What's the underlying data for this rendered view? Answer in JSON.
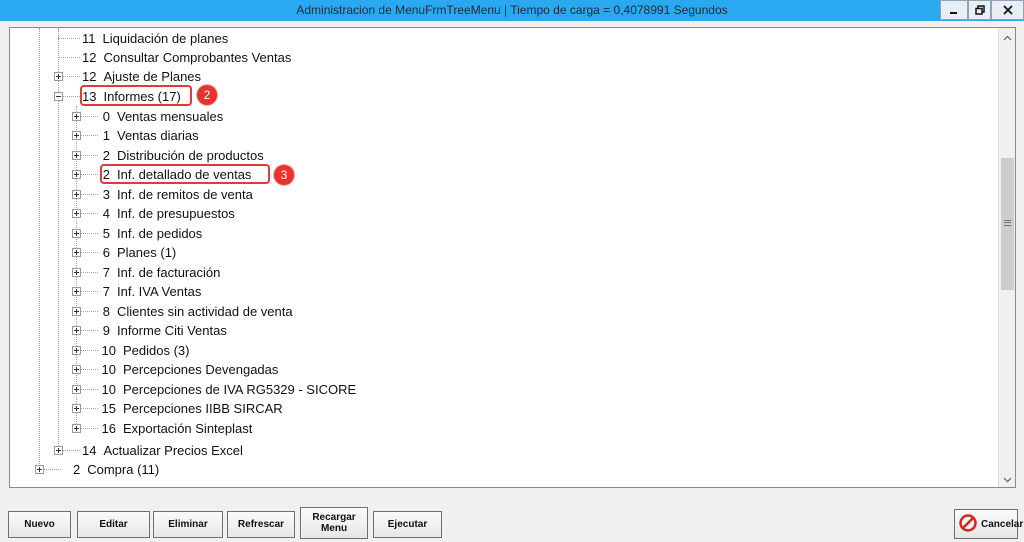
{
  "window": {
    "title": "Administracion de MenuFrmTreeMenu | Tiempo de carga = 0,4078991 Segundos",
    "controls": [
      "minimize-icon",
      "restore-icon",
      "close-icon"
    ]
  },
  "tree": {
    "items": [
      {
        "num": "11",
        "label": "Liquidación de planes",
        "expander": "none"
      },
      {
        "num": "12",
        "label": "Consultar Comprobantes Ventas",
        "expander": "none"
      },
      {
        "num": "12",
        "label": "Ajuste de Planes",
        "expander": "plus"
      },
      {
        "num": "13",
        "label": "Informes (17)",
        "expander": "minus"
      },
      {
        "num": "0",
        "label": "Ventas mensuales",
        "expander": "plus"
      },
      {
        "num": "1",
        "label": "Ventas diarias",
        "expander": "plus"
      },
      {
        "num": "2",
        "label": "Distribución de productos",
        "expander": "plus"
      },
      {
        "num": "2",
        "label": "Inf. detallado de ventas",
        "expander": "plus"
      },
      {
        "num": "3",
        "label": "Inf. de remitos de venta",
        "expander": "plus"
      },
      {
        "num": "4",
        "label": "Inf. de presupuestos",
        "expander": "plus"
      },
      {
        "num": "5",
        "label": "Inf. de pedidos",
        "expander": "plus"
      },
      {
        "num": "6",
        "label": "Planes (1)",
        "expander": "plus"
      },
      {
        "num": "7",
        "label": "Inf. de facturación",
        "expander": "plus"
      },
      {
        "num": "7",
        "label": "Inf. IVA Ventas",
        "expander": "plus"
      },
      {
        "num": "8",
        "label": "Clientes sin actividad de venta",
        "expander": "plus"
      },
      {
        "num": "9",
        "label": "Informe Citi Ventas",
        "expander": "plus"
      },
      {
        "num": "10",
        "label": "Pedidos (3)",
        "expander": "plus"
      },
      {
        "num": "10",
        "label": "Percepciones Devengadas",
        "expander": "plus"
      },
      {
        "num": "10",
        "label": "Percepciones de IVA RG5329 - SICORE",
        "expander": "plus"
      },
      {
        "num": "15",
        "label": "Percepciones IIBB SIRCAR",
        "expander": "plus"
      },
      {
        "num": "16",
        "label": "Exportación Sinteplast",
        "expander": "plus"
      },
      {
        "num": "14",
        "label": "Actualizar Precios Excel",
        "expander": "plus"
      },
      {
        "num": "2",
        "label": "Compra (11)",
        "expander": "plus"
      }
    ],
    "callouts": [
      "2",
      "3"
    ]
  },
  "buttons": {
    "nuevo": "Nuevo",
    "editar": "Editar",
    "eliminar": "Eliminar",
    "refrescar": "Refrescar",
    "recargar_menu": "Recargar Menu",
    "ejecutar": "Ejecutar",
    "cancelar": "Cancelar"
  },
  "colors": {
    "titlebar": "#2aa8f0",
    "highlight": "#e23a3a",
    "callout": "#e8322e"
  }
}
